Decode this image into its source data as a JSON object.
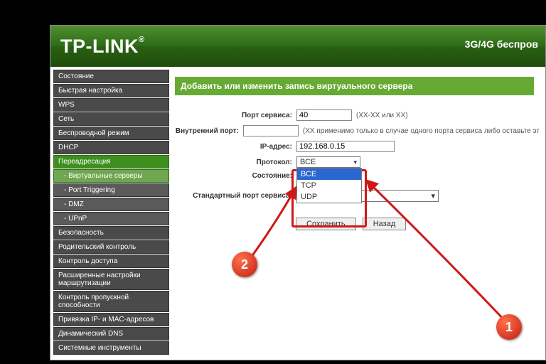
{
  "banner": {
    "logo": "TP-LINK",
    "right": "3G/4G беспров"
  },
  "sidebar": {
    "items": [
      {
        "label": "Состояние"
      },
      {
        "label": "Быстрая настройка"
      },
      {
        "label": "WPS"
      },
      {
        "label": "Сеть"
      },
      {
        "label": "Беспроводной режим"
      },
      {
        "label": "DHCP"
      },
      {
        "label": "Переадресация",
        "selected": true
      },
      {
        "label": "- Виртуальные серверы",
        "sub": true,
        "selected": true
      },
      {
        "label": "- Port Triggering",
        "sub": true
      },
      {
        "label": "- DMZ",
        "sub": true
      },
      {
        "label": "- UPnP",
        "sub": true
      },
      {
        "label": "Безопасность"
      },
      {
        "label": "Родительский контроль"
      },
      {
        "label": "Контроль доступа"
      },
      {
        "label": "Расширенные настройки маршрутизации"
      },
      {
        "label": "Контроль пропускной способности"
      },
      {
        "label": "Привязка IP- и MAC-адресов"
      },
      {
        "label": "Динамический DNS"
      },
      {
        "label": "Системные инструменты"
      }
    ]
  },
  "page": {
    "title": "Добавить или изменить запись виртуального сервера",
    "fields": {
      "servicePort": {
        "label": "Порт сервиса:",
        "value": "40",
        "hint": "(XX-XX или XX)"
      },
      "internalPort": {
        "label": "Внутренний порт:",
        "value": "",
        "hint": "(XX применимо только в случае одного порта сервиса либо оставьте эт"
      },
      "ip": {
        "label": "IP-адрес:",
        "value": "192.168.0.15"
      },
      "protocol": {
        "label": "Протокол:",
        "selected": "ВСЕ",
        "options": [
          "ВСЕ",
          "TCP",
          "UDP"
        ]
      },
      "state": {
        "label": "Состояние:"
      },
      "stdPort": {
        "label": "Стандартный порт сервиса:"
      }
    },
    "buttons": {
      "save": "Сохранить",
      "back": "Назад"
    }
  },
  "annotation": {
    "b1": "1",
    "b2": "2"
  }
}
